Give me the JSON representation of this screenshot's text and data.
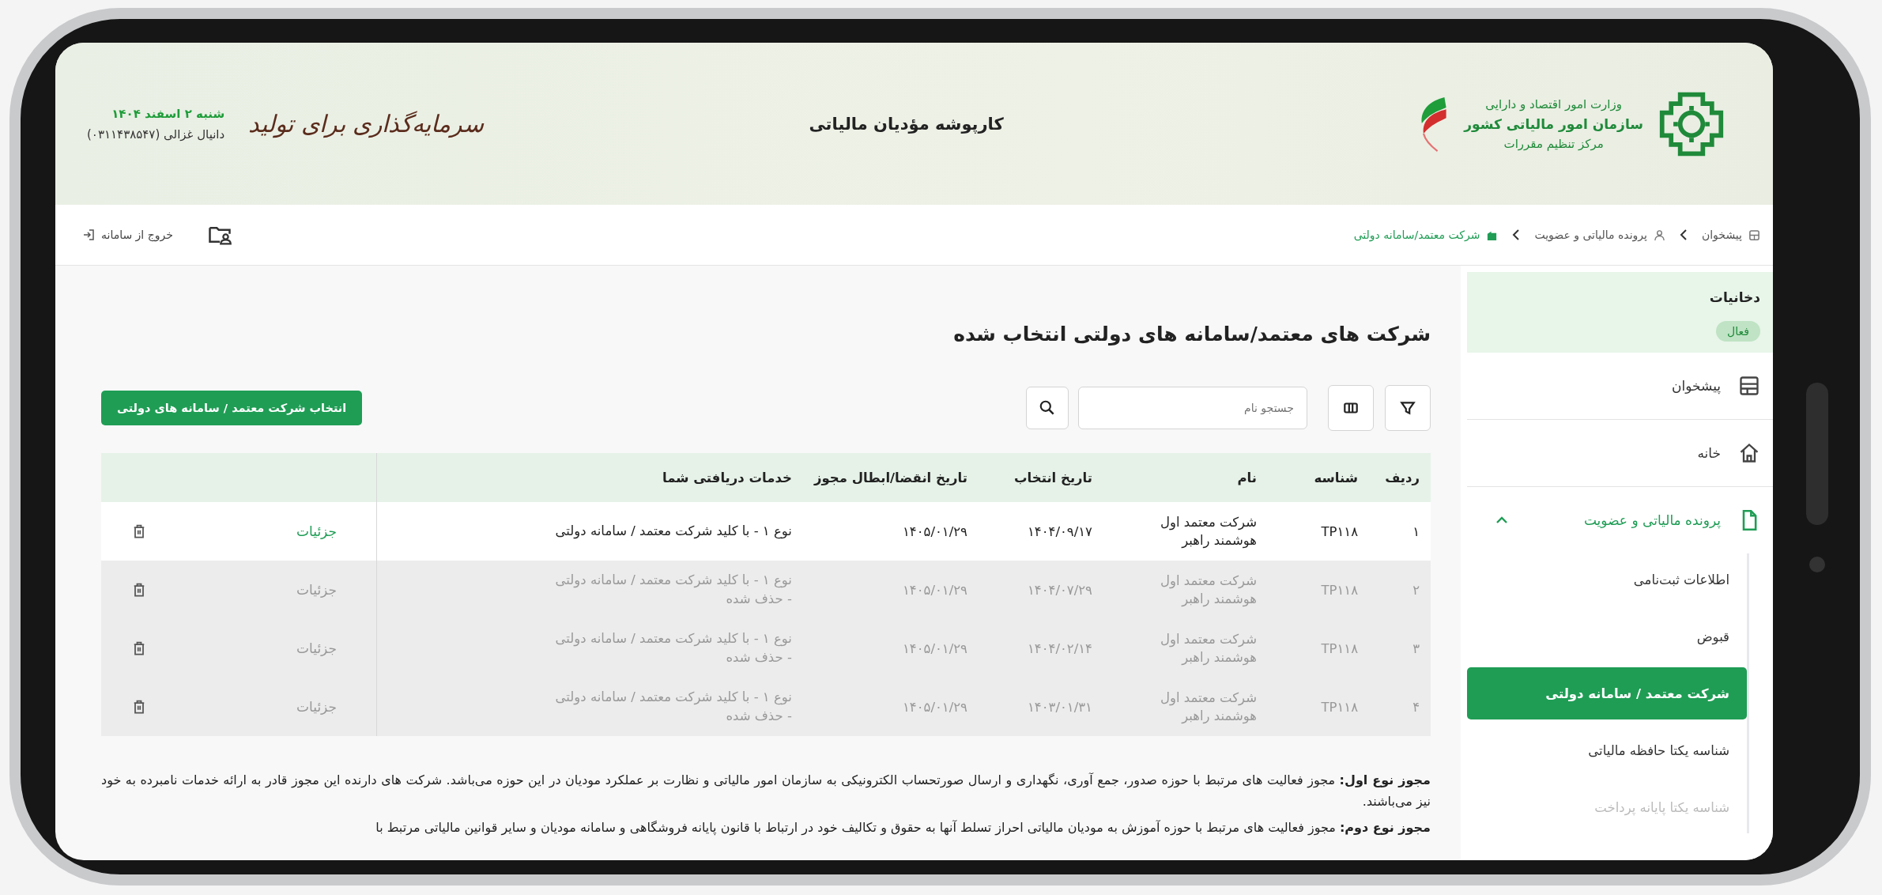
{
  "header": {
    "ministry": "وزارت امور اقتصاد و دارایی",
    "organization": "سازمان امور مالیاتی کشور",
    "center": "مرکز تنظیم مقررات",
    "title": "کارپوشه مؤدیان مالیاتی",
    "slogan": "سرمایه‌گذاری برای تولید",
    "date": "شنبه ۲ اسفند ۱۴۰۴",
    "user": "دانیال غزالی (۰۳۱۱۴۳۸۵۴۷)"
  },
  "breadcrumb": [
    {
      "label": "پیشخوان",
      "selected": false
    },
    {
      "label": "پرونده مالیاتی و عضویت",
      "selected": false
    },
    {
      "label": "شرکت معتمد/سامانه دولتی",
      "selected": true
    }
  ],
  "logout": "خروج از سامانه",
  "page_title": "شرکت های معتمد/سامانه های دولتی انتخاب شده",
  "toolbar": {
    "search": {
      "placeholder": "جستجو نام"
    },
    "add_button": "انتخاب شرکت معتمد / سامانه های دولتی"
  },
  "table": {
    "columns": [
      "ردیف",
      "شناسه",
      "نام",
      "تاریخ انتخاب",
      "تاریخ انقضا/ابطال مجوز",
      "خدمات دریافتی شما"
    ],
    "rows": [
      {
        "index": "۱",
        "id": "TP۱۱۸",
        "name": "شرکت معتمد اول هوشمند راهبر",
        "selected_date": "۱۴۰۴/۰۹/۱۷",
        "expiry_date": "۱۴۰۵/۰۱/۲۹",
        "service": "نوع ۱ - با کلید شرکت معتمد / سامانه دولتی",
        "action": "جزئیات",
        "deleted": false
      },
      {
        "index": "۲",
        "id": "TP۱۱۸",
        "name": "شرکت معتمد اول هوشمند راهبر",
        "selected_date": "۱۴۰۴/۰۷/۲۹",
        "expiry_date": "۱۴۰۵/۰۱/۲۹",
        "service": "نوع ۱ - با کلید شرکت معتمد / سامانه دولتی",
        "note": "- حذف شده",
        "action": "جزئیات",
        "deleted": true
      },
      {
        "index": "۳",
        "id": "TP۱۱۸",
        "name": "شرکت معتمد اول هوشمند راهبر",
        "selected_date": "۱۴۰۴/۰۲/۱۴",
        "expiry_date": "۱۴۰۵/۰۱/۲۹",
        "service": "نوع ۱ - با کلید شرکت معتمد / سامانه دولتی",
        "note": "- حذف شده",
        "action": "جزئیات",
        "deleted": true
      },
      {
        "index": "۴",
        "id": "TP۱۱۸",
        "name": "شرکت معتمد اول هوشمند راهبر",
        "selected_date": "۱۴۰۳/۰۱/۳۱",
        "expiry_date": "۱۴۰۵/۰۱/۲۹",
        "service": "نوع ۱ - با کلید شرکت معتمد / سامانه دولتی",
        "note": "- حذف شده",
        "action": "جزئیات",
        "deleted": true
      }
    ]
  },
  "notes": [
    "**مجوز نوع اول:** مجوز فعالیت های مرتبط با حوزه صدور، جمع آوری، نگهداری و ارسال صورتحساب الکترونیکی به سازمان امور مالیاتی و نظارت بر عملکرد مودیان در این حوزه می‌باشد. شرکت های دارنده این مجوز قادر به ارائه خدمات نامبرده به خود نیز می‌باشند.",
    "**مجوز نوع دوم:** مجوز فعالیت های مرتبط با حوزه آموزش به مودیان مالیاتی احراز تسلط آنها به حقوق و تکالیف خود در ارتباط با قانون پایانه فروشگاهی و سامانه مودیان و سایر قوانین مالیاتی مرتبط با"
  ],
  "sidebar": {
    "account": {
      "name": "دخانیات",
      "status": "فعال"
    },
    "items": [
      {
        "label": "پیشخوان",
        "expanded": false
      },
      {
        "label": "خانه",
        "expanded": false
      },
      {
        "label": "پرونده مالیاتی و عضویت",
        "expanded": true,
        "children": [
          {
            "label": "اطلاعات ثبت‌نامی",
            "selected": false,
            "disabled": false
          },
          {
            "label": "قبوض",
            "selected": false,
            "disabled": false
          },
          {
            "label": "شرکت معتمد / سامانه دولتی",
            "selected": true,
            "disabled": false
          },
          {
            "label": "شناسه یکتا حافظه مالیاتی",
            "selected": false,
            "disabled": false
          },
          {
            "label": "شناسه یکتا پایانه پرداخت",
            "selected": false,
            "disabled": true
          }
        ]
      }
    ]
  }
}
